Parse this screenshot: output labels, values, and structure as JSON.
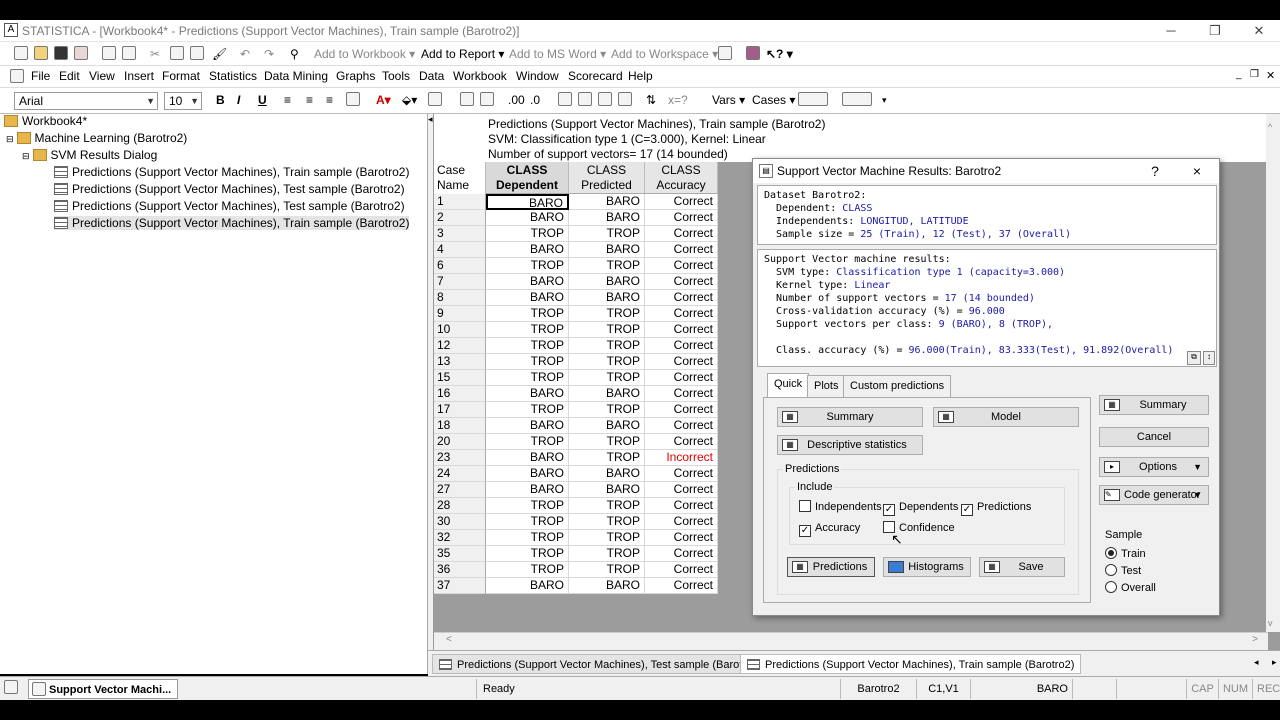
{
  "window": {
    "title": "STATISTICA - [Workbook4* - Predictions (Support Vector Machines), Train sample (Barotro2)]"
  },
  "toolbar1": {
    "add_workbook": "Add to Workbook",
    "add_report": "Add to Report",
    "add_msword": "Add to MS Word",
    "add_workspace": "Add to Workspace"
  },
  "menu": [
    "File",
    "Edit",
    "View",
    "Insert",
    "Format",
    "Statistics",
    "Data Mining",
    "Graphs",
    "Tools",
    "Data",
    "Workbook",
    "Window",
    "Scorecard",
    "Help"
  ],
  "toolbar2": {
    "font": "Arial",
    "size": "10",
    "vars": "Vars",
    "cases": "Cases"
  },
  "tree": {
    "root": "Workbook4*",
    "folder1": "Machine Learning (Barotro2)",
    "folder2": "SVM Results Dialog",
    "items": [
      "Predictions (Support Vector Machines), Train sample (Barotro2)",
      "Predictions (Support Vector Machines), Test sample (Barotro2)",
      "Predictions (Support Vector Machines), Test sample (Barotro2)",
      "Predictions (Support Vector Machines), Train sample (Barotro2)"
    ]
  },
  "sheet": {
    "header1": "Predictions (Support Vector Machines), Train sample  (Barotro2)",
    "header2": "SVM: Classification type 1 (C=3.000), Kernel:  Linear",
    "header3": "Number of support vectors= 17 (14 bounded)",
    "col0": [
      "Case",
      "Name"
    ],
    "col1": [
      "CLASS",
      "Dependent"
    ],
    "col2": [
      "CLASS",
      "Predicted"
    ],
    "col3": [
      "CLASS",
      "Accuracy"
    ],
    "rows": [
      [
        "1",
        "BARO",
        "BARO",
        "Correct"
      ],
      [
        "2",
        "BARO",
        "BARO",
        "Correct"
      ],
      [
        "3",
        "TROP",
        "TROP",
        "Correct"
      ],
      [
        "4",
        "BARO",
        "BARO",
        "Correct"
      ],
      [
        "6",
        "TROP",
        "TROP",
        "Correct"
      ],
      [
        "7",
        "BARO",
        "BARO",
        "Correct"
      ],
      [
        "8",
        "BARO",
        "BARO",
        "Correct"
      ],
      [
        "9",
        "TROP",
        "TROP",
        "Correct"
      ],
      [
        "10",
        "TROP",
        "TROP",
        "Correct"
      ],
      [
        "12",
        "TROP",
        "TROP",
        "Correct"
      ],
      [
        "13",
        "TROP",
        "TROP",
        "Correct"
      ],
      [
        "15",
        "TROP",
        "TROP",
        "Correct"
      ],
      [
        "16",
        "BARO",
        "BARO",
        "Correct"
      ],
      [
        "17",
        "TROP",
        "TROP",
        "Correct"
      ],
      [
        "18",
        "BARO",
        "BARO",
        "Correct"
      ],
      [
        "20",
        "TROP",
        "TROP",
        "Correct"
      ],
      [
        "23",
        "BARO",
        "TROP",
        "Incorrect"
      ],
      [
        "24",
        "BARO",
        "BARO",
        "Correct"
      ],
      [
        "27",
        "BARO",
        "BARO",
        "Correct"
      ],
      [
        "28",
        "TROP",
        "TROP",
        "Correct"
      ],
      [
        "30",
        "TROP",
        "TROP",
        "Correct"
      ],
      [
        "32",
        "TROP",
        "TROP",
        "Correct"
      ],
      [
        "35",
        "TROP",
        "TROP",
        "Correct"
      ],
      [
        "36",
        "TROP",
        "TROP",
        "Correct"
      ],
      [
        "37",
        "BARO",
        "BARO",
        "Correct"
      ]
    ]
  },
  "tabs": [
    "Predictions (Support Vector Machines), Test sample (Barotro2)",
    "Predictions (Support Vector Machines), Train sample (Barotro2)"
  ],
  "status": {
    "taskbar": "Support Vector Machi...",
    "ready": "Ready",
    "dataset": "Barotro2",
    "cell": "C1,V1",
    "value": "BARO",
    "cap": "CAP",
    "num": "NUM",
    "rec": "REC"
  },
  "dialog": {
    "title": "Support Vector Machine Results: Barotro2",
    "help": "?",
    "close": "×",
    "info1": {
      "l1": "Dataset Barotro2:",
      "l2a": "  Dependent: ",
      "l2b": "CLASS",
      "l3a": "  Independents: ",
      "l3b": "LONGITUD, LATITUDE",
      "l4a": "  Sample size = ",
      "l4b": "25 (Train), 12 (Test), 37 (Overall)"
    },
    "info2": {
      "l1": "Support Vector machine results:",
      "l2a": "  SVM type: ",
      "l2b": "Classification type 1 (capacity=3.000)",
      "l3a": "  Kernel type: ",
      "l3b": "Linear",
      "l4a": "  Number of support vectors = ",
      "l4b": "17 (14 bounded)",
      "l5a": "  Cross-validation accuracy (%) = ",
      "l5b": "96.000",
      "l6a": "  Support vectors per class: ",
      "l6b": "9 (BARO), 8 (TROP),",
      "l7a": "  Class. accuracy (%) = ",
      "l7b": "96.000(Train), 83.333(Test), 91.892(Overall)"
    },
    "tabs": [
      "Quick",
      "Plots",
      "Custom predictions"
    ],
    "summary_btn": "Summary",
    "model_btn": "Model",
    "desc_btn": "Descriptive statistics",
    "predictions_group": "Predictions",
    "include_group": "Include",
    "chk_independents": "Independents",
    "chk_dependents": "Dependents",
    "chk_predictions": "Predictions",
    "chk_accuracy": "Accuracy",
    "chk_confidence": "Confidence",
    "predictions_btn": "Predictions",
    "histograms_btn": "Histograms",
    "save_btn": "Save",
    "right_summary": "Summary",
    "cancel": "Cancel",
    "options": "Options",
    "code_gen": "Code generator",
    "sample_group": "Sample",
    "r_train": "Train",
    "r_test": "Test",
    "r_overall": "Overall"
  }
}
